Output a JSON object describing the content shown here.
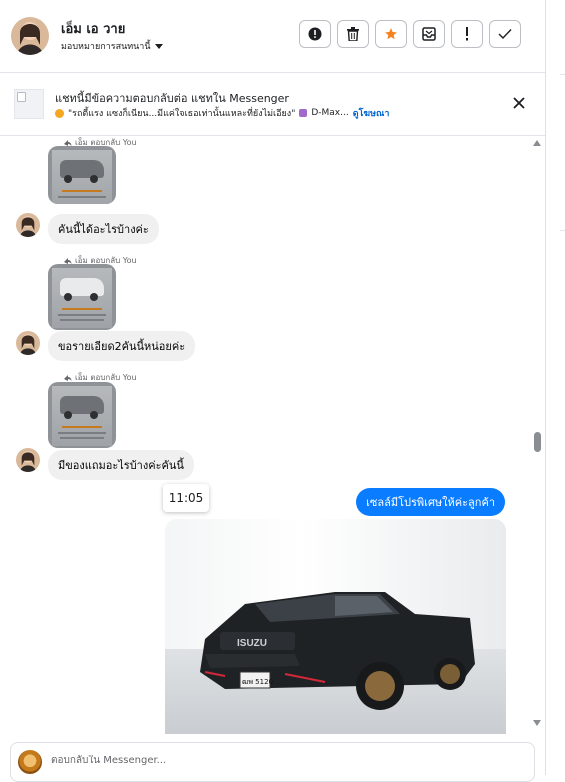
{
  "header": {
    "contact_name": "เอ็ม เอ วาย",
    "assignee_label": "มอบหมายการสนทนานี้",
    "actions": [
      {
        "icon": "alert-circle-icon"
      },
      {
        "icon": "trash-icon"
      },
      {
        "icon": "star-icon",
        "color": "#f5821f"
      },
      {
        "icon": "mark-unread-icon"
      },
      {
        "icon": "exclamation-icon"
      },
      {
        "icon": "check-icon"
      }
    ]
  },
  "banner": {
    "title": "แชทนี้มีข้อความตอบกลับต่อ แชทใน Messenger",
    "subtitle": "\"รถตี้แรง แซงก็เนียน...มีแค่ใจเธอเท่านั้นแหละที่ยังไม่เอียง\"",
    "product": "D-Max...",
    "link": "ดูโฆษณา"
  },
  "messages": [
    {
      "reply_label": "เอ็ม ตอบกลับ You",
      "text": "คันนี้ได้อะไรบ้างค่ะ"
    },
    {
      "reply_label": "เอ็ม ตอบกลับ You",
      "text": "ขอรายเอียด2คันนี้หน่อยค่ะ"
    },
    {
      "reply_label": "เอ็ม ตอบกลับ You",
      "text": "มีของแถมอะไรบ้างค่ะคันนี้"
    }
  ],
  "time_tooltip": "11:05",
  "outgoing": {
    "text": "เซลล์มีโปรพิเศษให้ค่ะลูกค้า"
  },
  "photo": {
    "brand_text": "ISUZU",
    "plate_text": "ฒพ 5120"
  },
  "composer": {
    "placeholder": "ตอบกลับใน Messenger..."
  },
  "colors": {
    "accent": "#0a7cff",
    "star": "#f5821f",
    "link": "#0064d1"
  }
}
